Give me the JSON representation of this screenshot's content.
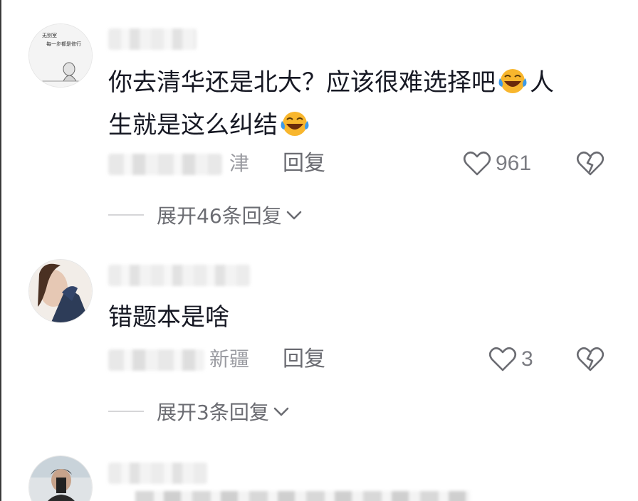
{
  "comments": [
    {
      "text_line1": "你去清华还是北大？应该很难选择吧",
      "text_line1_end": "人",
      "text_line2": "生就是这么纠结",
      "location": "津",
      "reply_label": "回复",
      "like_count": "961",
      "expand_label": "展开46条回复",
      "avatar_text_1": "无别室",
      "avatar_text_2": "每一步都是修行"
    },
    {
      "text": "错题本是啥",
      "location": "新疆",
      "reply_label": "回复",
      "like_count": "3",
      "expand_label": "展开3条回复"
    }
  ],
  "icons": {
    "like": "heart-outline-icon",
    "dislike": "broken-heart-icon",
    "emoji": "laughing-tears-emoji",
    "expand": "chevron-down-icon"
  },
  "colors": {
    "primary_text": "#161823",
    "secondary_text": "#6b6c72",
    "muted_text": "#9a9ba1",
    "emoji_yellow": "#f8b62d"
  }
}
